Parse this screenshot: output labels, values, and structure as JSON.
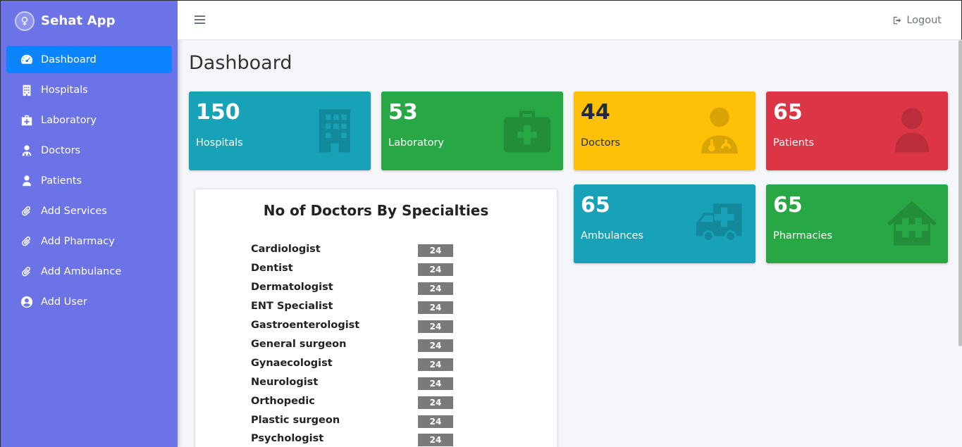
{
  "brand": {
    "name": "Sehat App"
  },
  "sidebar": {
    "items": [
      {
        "label": "Dashboard",
        "icon": "tachometer-icon"
      },
      {
        "label": "Hospitals",
        "icon": "hospital-icon"
      },
      {
        "label": "Laboratory",
        "icon": "medkit-icon"
      },
      {
        "label": "Doctors",
        "icon": "user-md-icon"
      },
      {
        "label": "Patients",
        "icon": "user-icon"
      },
      {
        "label": "Add Services",
        "icon": "paperclip-icon"
      },
      {
        "label": "Add Pharmacy",
        "icon": "paperclip-icon"
      },
      {
        "label": "Add Ambulance",
        "icon": "paperclip-icon"
      },
      {
        "label": "Add User",
        "icon": "user-circle-icon"
      }
    ]
  },
  "topbar": {
    "logout_label": "Logout"
  },
  "page": {
    "title": "Dashboard"
  },
  "stats": {
    "hospitals": {
      "value": "150",
      "label": "Hospitals",
      "color": "#17a2b8"
    },
    "laboratory": {
      "value": "53",
      "label": "Laboratory",
      "color": "#28a745"
    },
    "doctors": {
      "value": "44",
      "label": "Doctors",
      "color": "#ffc107"
    },
    "patients": {
      "value": "65",
      "label": "Patients",
      "color": "#dc3545"
    },
    "ambulances": {
      "value": "65",
      "label": "Ambulances",
      "color": "#17a2b8"
    },
    "pharmacies": {
      "value": "65",
      "label": "Pharmacies",
      "color": "#28a745"
    }
  },
  "specialties": {
    "title": "No of Doctors By Specialties",
    "rows": [
      {
        "name": "Cardiologist",
        "count": "24"
      },
      {
        "name": "Dentist",
        "count": "24"
      },
      {
        "name": "Dermatologist",
        "count": "24"
      },
      {
        "name": "ENT Specialist",
        "count": "24"
      },
      {
        "name": "Gastroenterologist",
        "count": "24"
      },
      {
        "name": "General surgeon",
        "count": "24"
      },
      {
        "name": "Gynaecologist",
        "count": "24"
      },
      {
        "name": "Neurologist",
        "count": "24"
      },
      {
        "name": "Orthopedic",
        "count": "24"
      },
      {
        "name": "Plastic surgeon",
        "count": "24"
      },
      {
        "name": "Psychologist",
        "count": "24"
      }
    ]
  },
  "colors": {
    "sidebar": "#6b73e6",
    "active": "#0d84ff"
  }
}
